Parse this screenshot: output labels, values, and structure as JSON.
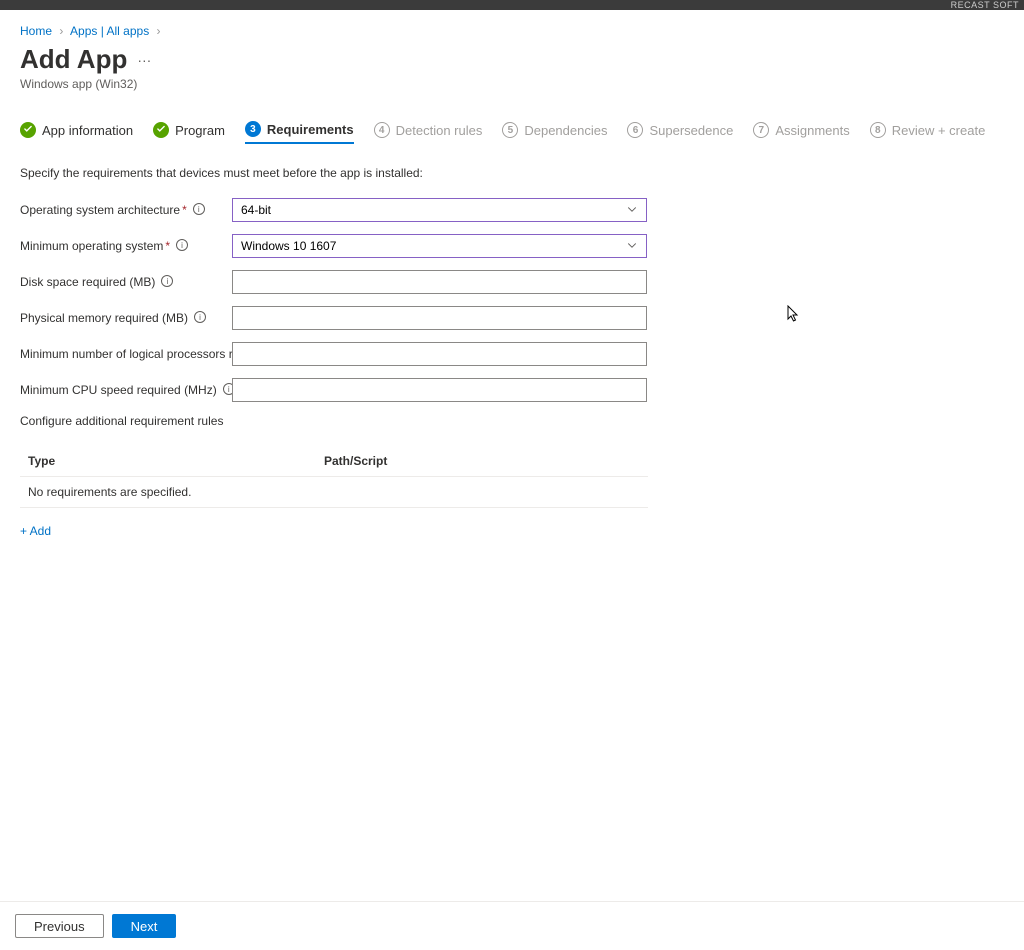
{
  "watermark": "RECAST SOFT",
  "breadcrumb": {
    "home": "Home",
    "apps": "Apps | All apps"
  },
  "page": {
    "title": "Add App",
    "subtitle": "Windows app (Win32)"
  },
  "tabs": [
    {
      "num": "",
      "label": "App information",
      "state": "done"
    },
    {
      "num": "",
      "label": "Program",
      "state": "done"
    },
    {
      "num": "3",
      "label": "Requirements",
      "state": "active"
    },
    {
      "num": "4",
      "label": "Detection rules",
      "state": "pending"
    },
    {
      "num": "5",
      "label": "Dependencies",
      "state": "pending"
    },
    {
      "num": "6",
      "label": "Supersedence",
      "state": "pending"
    },
    {
      "num": "7",
      "label": "Assignments",
      "state": "pending"
    },
    {
      "num": "8",
      "label": "Review + create",
      "state": "pending"
    }
  ],
  "helpText": "Specify the requirements that devices must meet before the app is installed:",
  "form": {
    "osArch": {
      "label": "Operating system architecture",
      "required": true,
      "value": "64-bit"
    },
    "minOs": {
      "label": "Minimum operating system",
      "required": true,
      "value": "Windows 10 1607"
    },
    "diskSpace": {
      "label": "Disk space required (MB)",
      "value": ""
    },
    "physMem": {
      "label": "Physical memory required (MB)",
      "value": ""
    },
    "minProc": {
      "label": "Minimum number of logical processors required",
      "value": ""
    },
    "minCpu": {
      "label": "Minimum CPU speed required (MHz)",
      "value": ""
    }
  },
  "rules": {
    "heading": "Configure additional requirement rules",
    "cols": {
      "type": "Type",
      "path": "Path/Script"
    },
    "empty": "No requirements are specified.",
    "addLabel": "+ Add"
  },
  "buttons": {
    "prev": "Previous",
    "next": "Next"
  }
}
